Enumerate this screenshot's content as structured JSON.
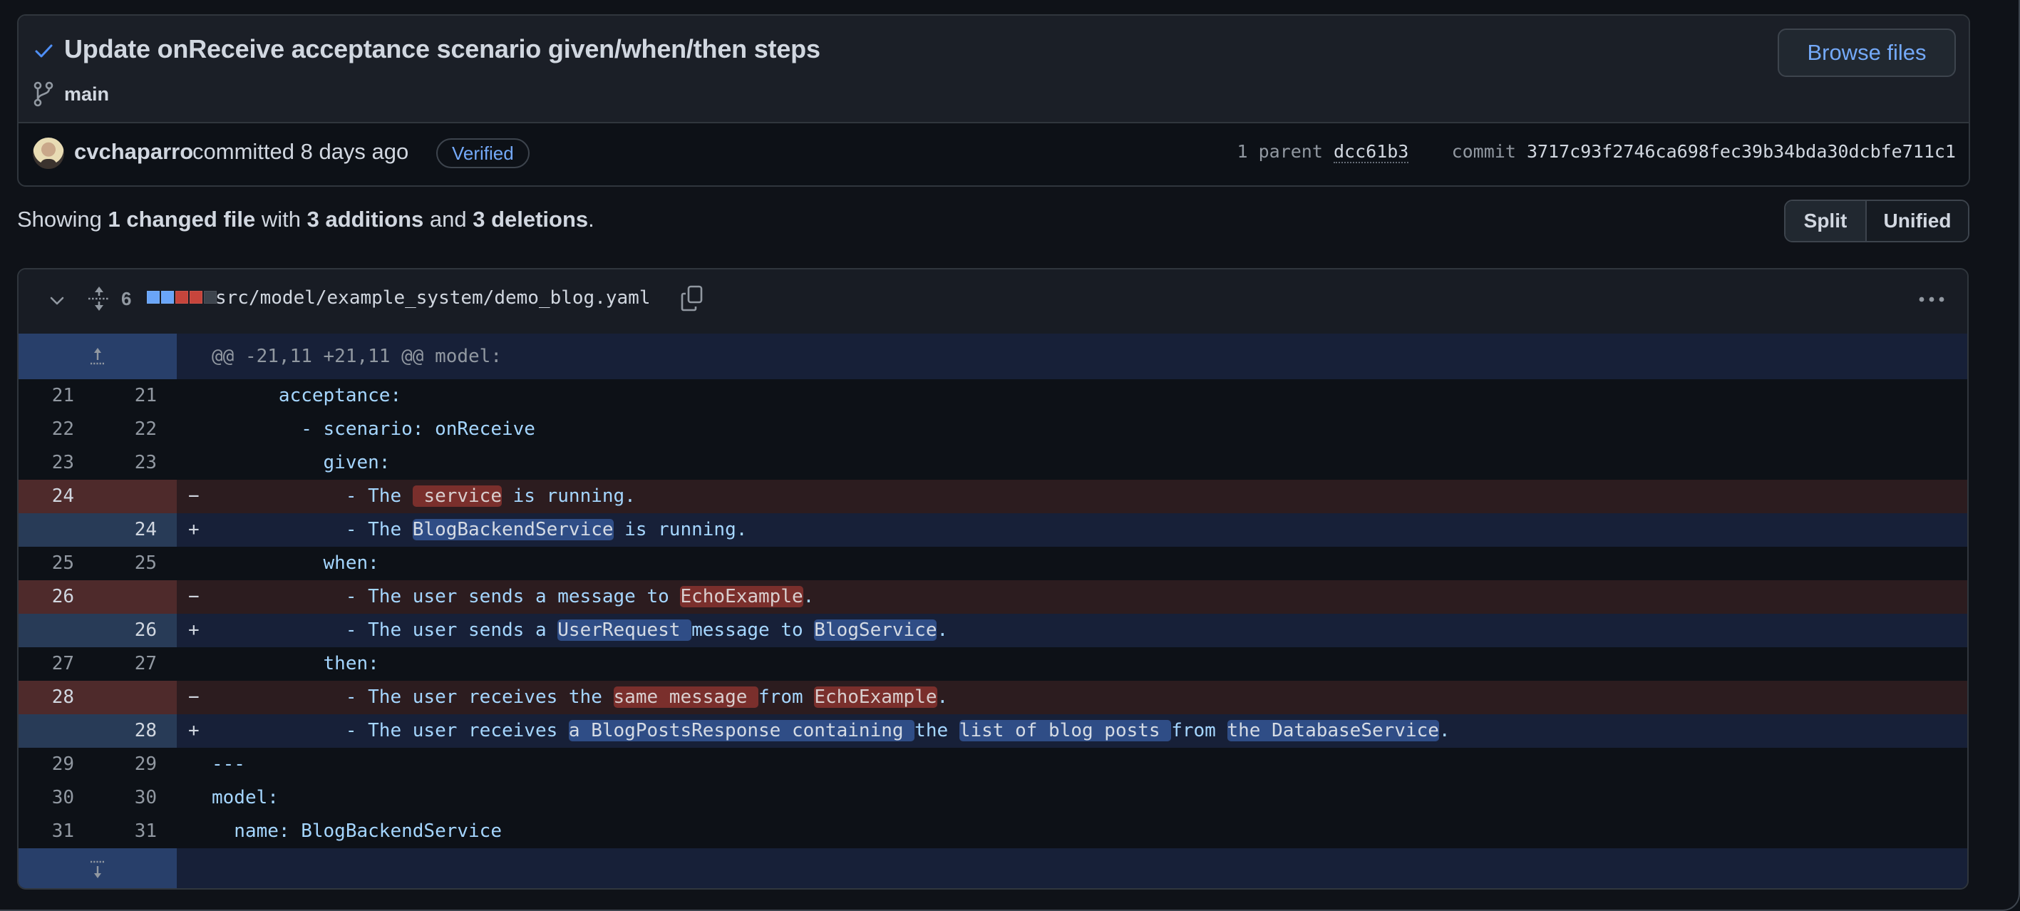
{
  "commit": {
    "title": "Update onReceive acceptance scenario given/when/then steps",
    "status_icon": "check-icon",
    "branch": "main",
    "browse_files_label": "Browse files",
    "author": "cvchaparro",
    "committed_text": "committed 8 days ago",
    "verified_label": "Verified",
    "parent_count_label": "1 parent",
    "parent_hash": "dcc61b3",
    "commit_label": "commit",
    "commit_hash": "3717c93f2746ca698fec39b34bda30dcbfe711c1"
  },
  "summary": {
    "prefix": "Showing ",
    "files_changed": "1 changed file",
    "with": " with ",
    "additions": "3 additions",
    "and": " and ",
    "deletions": "3 deletions",
    "suffix": "."
  },
  "view_toggle": {
    "split_label": "Split",
    "unified_label": "Unified",
    "selected": "Split"
  },
  "file": {
    "changes_count": "6",
    "diffstat": [
      "add",
      "add",
      "del",
      "del",
      "neutral"
    ],
    "path": "src/model/example_system/demo_blog.yaml",
    "hunk_header": "@@ -21,11 +21,11 @@ model:",
    "lines": [
      {
        "type": "ctx",
        "old": "21",
        "new": "21",
        "segments": [
          {
            "t": "      acceptance:"
          }
        ]
      },
      {
        "type": "ctx",
        "old": "22",
        "new": "22",
        "segments": [
          {
            "t": "        - scenario: onReceive"
          }
        ]
      },
      {
        "type": "ctx",
        "old": "23",
        "new": "23",
        "segments": [
          {
            "t": "          given:"
          }
        ]
      },
      {
        "type": "del",
        "old": "24",
        "new": "",
        "segments": [
          {
            "t": "            - The "
          },
          {
            "t": " service",
            "hl": true
          },
          {
            "t": " is running."
          }
        ]
      },
      {
        "type": "add",
        "old": "",
        "new": "24",
        "segments": [
          {
            "t": "            - The "
          },
          {
            "t": "BlogBackendService",
            "hl": true
          },
          {
            "t": " is running."
          }
        ]
      },
      {
        "type": "ctx",
        "old": "25",
        "new": "25",
        "segments": [
          {
            "t": "          when:"
          }
        ]
      },
      {
        "type": "del",
        "old": "26",
        "new": "",
        "segments": [
          {
            "t": "            - The user sends a message to "
          },
          {
            "t": "EchoExample",
            "hl": true
          },
          {
            "t": "."
          }
        ]
      },
      {
        "type": "add",
        "old": "",
        "new": "26",
        "segments": [
          {
            "t": "            - The user sends a "
          },
          {
            "t": "UserRequest ",
            "hl": true
          },
          {
            "t": "message to "
          },
          {
            "t": "BlogService",
            "hl": true
          },
          {
            "t": "."
          }
        ]
      },
      {
        "type": "ctx",
        "old": "27",
        "new": "27",
        "segments": [
          {
            "t": "          then:"
          }
        ]
      },
      {
        "type": "del",
        "old": "28",
        "new": "",
        "segments": [
          {
            "t": "            - The user receives the "
          },
          {
            "t": "same message ",
            "hl": true
          },
          {
            "t": "from "
          },
          {
            "t": "EchoExample",
            "hl": true
          },
          {
            "t": "."
          }
        ]
      },
      {
        "type": "add",
        "old": "",
        "new": "28",
        "segments": [
          {
            "t": "            - The user receives "
          },
          {
            "t": "a BlogPostsResponse containing ",
            "hl": true
          },
          {
            "t": "the "
          },
          {
            "t": "list of blog posts ",
            "hl": true
          },
          {
            "t": "from "
          },
          {
            "t": "the DatabaseService",
            "hl": true
          },
          {
            "t": "."
          }
        ]
      },
      {
        "type": "ctx",
        "old": "29",
        "new": "29",
        "segments": [
          {
            "t": "---"
          }
        ]
      },
      {
        "type": "ctx",
        "old": "30",
        "new": "30",
        "segments": [
          {
            "t": "model:"
          }
        ]
      },
      {
        "type": "ctx",
        "old": "31",
        "new": "31",
        "segments": [
          {
            "t": "  name: BlogBackendService"
          }
        ]
      }
    ]
  },
  "colors": {
    "accent_blue": "#74a9f8",
    "diff_add_square": "#6aa5f8",
    "diff_del_square": "#c6453c",
    "diff_neutral_square": "#3d444d"
  }
}
